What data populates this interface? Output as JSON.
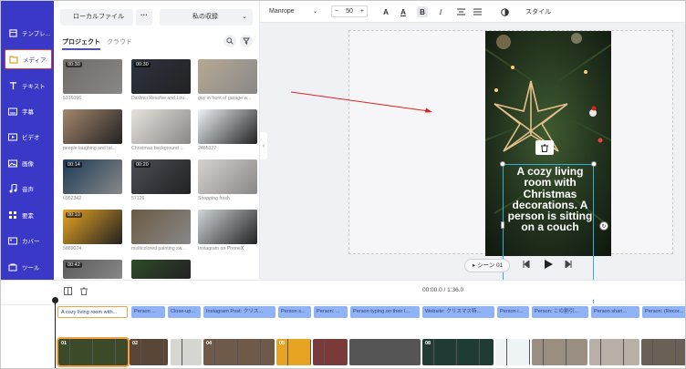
{
  "nav": {
    "items": [
      {
        "label": "テンプレ...",
        "icon": "template-icon"
      },
      {
        "label": "メディア",
        "icon": "folder-icon",
        "active": true
      },
      {
        "label": "テキスト",
        "icon": "text-icon"
      },
      {
        "label": "字幕",
        "icon": "subtitle-icon"
      },
      {
        "label": "ビデオ",
        "icon": "video-icon"
      },
      {
        "label": "画像",
        "icon": "image-icon"
      },
      {
        "label": "音声",
        "icon": "music-icon"
      },
      {
        "label": "要素",
        "icon": "elements-icon"
      },
      {
        "label": "カバー",
        "icon": "cover-icon"
      },
      {
        "label": "ツール",
        "icon": "tools-icon"
      }
    ]
  },
  "panel": {
    "local_files": "ローカルファイル",
    "more": "···",
    "collection": "私の収録",
    "tabs": {
      "project": "プロジェクト",
      "cloud": "クラウド"
    },
    "media": [
      {
        "caption": "5316096",
        "duration": "00:30",
        "color": "#6f6b66"
      },
      {
        "caption": "DaVinci Resolve and Lou...",
        "duration": "00:30",
        "color": "#2c3340"
      },
      {
        "caption": "guy in front of garage w...",
        "duration": "",
        "color": "#b7a894"
      },
      {
        "caption": "people laughing and tal...",
        "duration": "",
        "color": "#a4876e"
      },
      {
        "caption": "Christmas background ...",
        "duration": "",
        "color": "#e8e3dc"
      },
      {
        "caption": "2465327",
        "duration": "",
        "color": "#eef3f6"
      },
      {
        "caption": "6952342",
        "duration": "00:14",
        "color": "#1c3a57"
      },
      {
        "caption": "57126",
        "duration": "00:20",
        "color": "#4a4e56"
      },
      {
        "caption": "Shopping fresh",
        "duration": "",
        "color": "#d7d2cd"
      },
      {
        "caption": "5889074",
        "duration": "00:10",
        "color": "#e7a322"
      },
      {
        "caption": "multicolored painting sw...",
        "duration": "",
        "color": "#6b5a43"
      },
      {
        "caption": "Instagram on PhoneX",
        "duration": "",
        "color": "#cfd5d8"
      },
      {
        "caption": "",
        "duration": "00:42",
        "color": "#5a5a5a"
      },
      {
        "caption": "",
        "duration": "",
        "color": "#2f4a2a"
      }
    ]
  },
  "toolbar": {
    "font": "Manrope",
    "size": "50",
    "minus": "−",
    "plus": "+",
    "color": "A",
    "highlight": "A",
    "bold": "B",
    "italic": "I",
    "style": "スタイル"
  },
  "canvas": {
    "text": "A cozy living room with Christmas decorations. A person is sitting on a couch",
    "scene": "シーン 01"
  },
  "timeline": {
    "time": "00:00.0 / 1:36.0",
    "captions": [
      "A cozy living room with...",
      "Person ...",
      "Close-up...",
      "Instagram Post: クリス...",
      "Person s...",
      "Person: ...",
      "Person typing on their l...",
      "Website: クリスマス特...",
      "Person i...",
      "Person: この割引...",
      "Person shari...",
      "Person: (Recor..."
    ],
    "clips": [
      {
        "num": "01",
        "color": "#3d4a2a"
      },
      {
        "num": "02",
        "color": "#5a4636"
      },
      {
        "num": "",
        "color": "#d7d7d2"
      },
      {
        "num": "04",
        "color": "#6f5a4a"
      },
      {
        "num": "05",
        "color": "#e7a322"
      },
      {
        "num": "",
        "color": "#7a3a3a"
      },
      {
        "num": "",
        "color": "#555"
      },
      {
        "num": "08",
        "color": "#1f3b34"
      },
      {
        "num": "",
        "color": "#eef3f6"
      },
      {
        "num": "",
        "color": "#9a8e80"
      },
      {
        "num": "",
        "color": "#b8b0a6"
      },
      {
        "num": "",
        "color": "#6a6055"
      }
    ]
  }
}
